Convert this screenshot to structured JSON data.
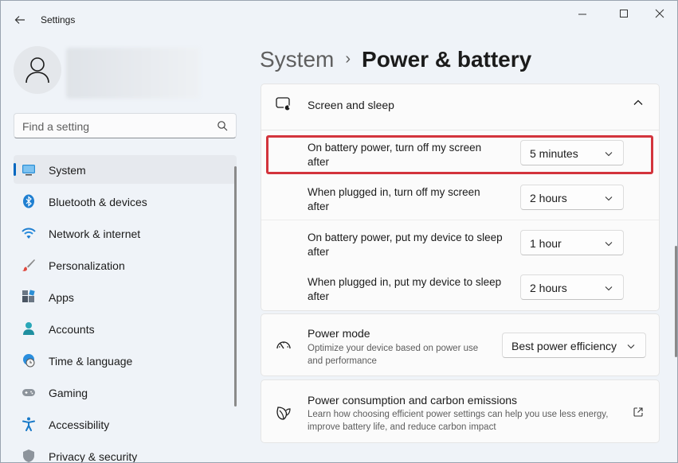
{
  "window": {
    "title": "Settings"
  },
  "profile": {},
  "search": {
    "placeholder": "Find a setting"
  },
  "sidebar": {
    "items": [
      {
        "label": "System",
        "icon": "system-icon",
        "active": true
      },
      {
        "label": "Bluetooth & devices",
        "icon": "bluetooth-icon"
      },
      {
        "label": "Network & internet",
        "icon": "wifi-icon"
      },
      {
        "label": "Personalization",
        "icon": "brush-icon"
      },
      {
        "label": "Apps",
        "icon": "apps-icon"
      },
      {
        "label": "Accounts",
        "icon": "accounts-icon"
      },
      {
        "label": "Time & language",
        "icon": "globe-clock-icon"
      },
      {
        "label": "Gaming",
        "icon": "gamepad-icon"
      },
      {
        "label": "Accessibility",
        "icon": "accessibility-icon"
      },
      {
        "label": "Privacy & security",
        "icon": "shield-icon"
      }
    ]
  },
  "breadcrumb": {
    "parent": "System",
    "separator": "›",
    "current": "Power & battery"
  },
  "screen_sleep": {
    "title": "Screen and sleep",
    "rows": [
      {
        "label": "On battery power, turn off my screen after",
        "value": "5 minutes"
      },
      {
        "label": "When plugged in, turn off my screen after",
        "value": "2 hours"
      },
      {
        "label": "On battery power, put my device to sleep after",
        "value": "1 hour"
      },
      {
        "label": "When plugged in, put my device to sleep after",
        "value": "2 hours"
      }
    ]
  },
  "power_mode": {
    "title": "Power mode",
    "subtitle": "Optimize your device based on power use and performance",
    "value": "Best power efficiency"
  },
  "carbon": {
    "title": "Power consumption and carbon emissions",
    "subtitle": "Learn how choosing efficient power settings can help you use less energy, improve battery life, and reduce carbon impact"
  },
  "colors": {
    "accent": "#0067c0",
    "highlight": "#d3343c"
  }
}
